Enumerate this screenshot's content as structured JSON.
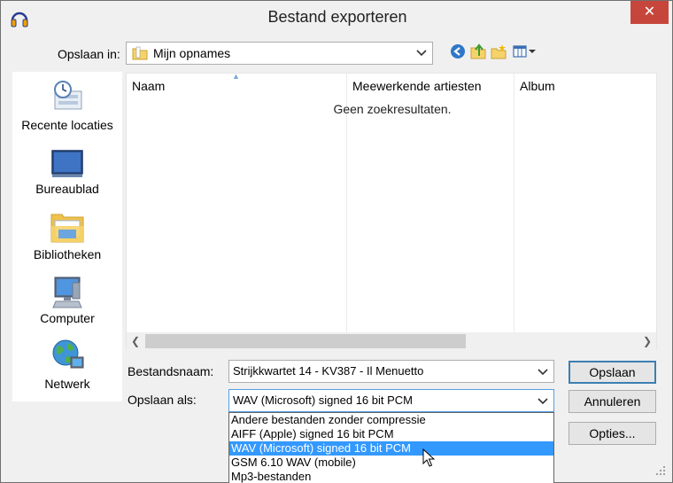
{
  "window": {
    "title": "Bestand exporteren",
    "close_glyph": "✕"
  },
  "location": {
    "label": "Opslaan in:",
    "value": "Mijn opnames"
  },
  "toolbar": {
    "icons": [
      "back-icon",
      "up-folder-icon",
      "new-folder-icon",
      "view-menu-icon"
    ]
  },
  "places": [
    {
      "label": "Recente locaties",
      "icon": "recent-places-icon"
    },
    {
      "label": "Bureaublad",
      "icon": "desktop-icon"
    },
    {
      "label": "Bibliotheken",
      "icon": "libraries-icon"
    },
    {
      "label": "Computer",
      "icon": "computer-icon"
    },
    {
      "label": "Netwerk",
      "icon": "network-icon"
    }
  ],
  "filelist": {
    "columns": [
      "Naam",
      "Meewerkende artiesten",
      "Album"
    ],
    "sort_indicator": "▲",
    "empty_message": "Geen zoekresultaten."
  },
  "filename": {
    "label": "Bestandsnaam:",
    "value": "Strijkkwartet 14 - KV387 - Il Menuetto"
  },
  "filetype": {
    "label": "Opslaan als:",
    "value": "WAV (Microsoft) signed 16 bit PCM",
    "options": [
      "Andere bestanden zonder compressie",
      "AIFF (Apple) signed 16 bit PCM",
      "WAV (Microsoft) signed 16 bit PCM",
      "GSM 6.10 WAV (mobile)",
      "Mp3-bestanden"
    ],
    "selected_index": 2
  },
  "buttons": {
    "save": "Opslaan",
    "cancel": "Annuleren",
    "options": "Opties..."
  },
  "colors": {
    "close": "#c7463b",
    "selection": "#3399ff",
    "default_border": "#3c7fb1"
  }
}
